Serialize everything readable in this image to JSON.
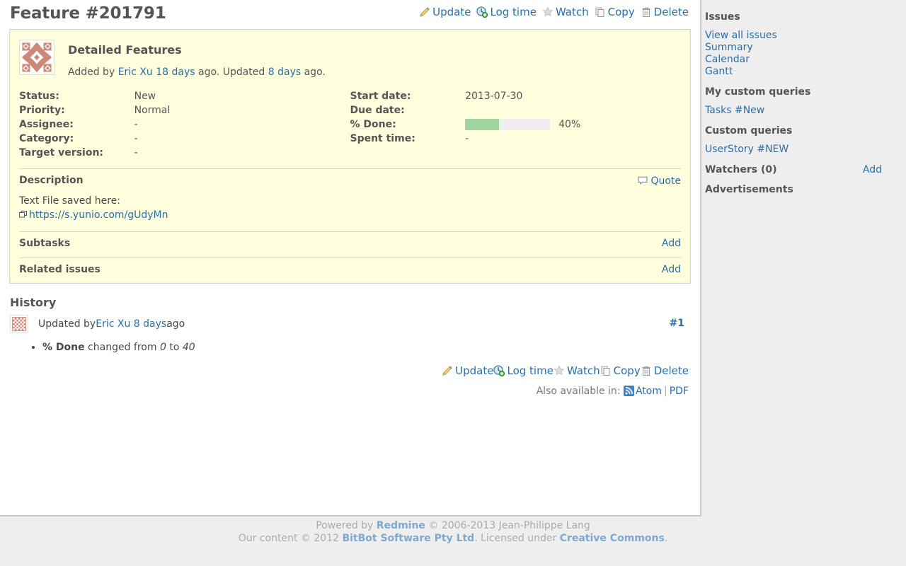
{
  "issue": {
    "title": "Feature #201791",
    "subject": "Detailed Features",
    "author_prefix": "Added by ",
    "author": "Eric Xu",
    "author_age": "18 days",
    "author_mid": " ago. Updated ",
    "updated_age": "8 days",
    "author_suffix": " ago."
  },
  "contextual": {
    "update": "Update",
    "log_time": "Log time",
    "watch": "Watch",
    "copy": "Copy",
    "delete": "Delete"
  },
  "attributes": {
    "status_label": "Status:",
    "status_value": "New",
    "priority_label": "Priority:",
    "priority_value": "Normal",
    "assignee_label": "Assignee:",
    "assignee_value": "-",
    "category_label": "Category:",
    "category_value": "-",
    "target_version_label": "Target version:",
    "target_version_value": "-",
    "start_date_label": "Start date:",
    "start_date_value": "2013-07-30",
    "due_date_label": "Due date:",
    "due_date_value": "",
    "done_label": "% Done:",
    "done_percent": 40,
    "done_text": "40%",
    "spent_time_label": "Spent time:",
    "spent_time_value": "-"
  },
  "description": {
    "heading": "Description",
    "quote": "Quote",
    "text": "Text File saved here:",
    "link": "https://s.yunio.com/gUdyMn"
  },
  "subtasks": {
    "heading": "Subtasks",
    "add": "Add"
  },
  "related": {
    "heading": "Related issues",
    "add": "Add"
  },
  "history": {
    "heading": "History",
    "entry_prefix": "Updated by ",
    "entry_user": "Eric Xu",
    "entry_age": "8 days",
    "entry_suffix": " ago",
    "anchor": "#1",
    "detail_field": "% Done",
    "detail_mid": " changed from ",
    "detail_old": "0",
    "detail_to": " to ",
    "detail_new": "40"
  },
  "other_formats": {
    "label": "Also available in:",
    "atom": "Atom",
    "separator": "|",
    "pdf": "PDF"
  },
  "sidebar": {
    "issues_heading": "Issues",
    "issue_links": [
      "View all issues",
      "Summary",
      "Calendar",
      "Gantt"
    ],
    "my_queries_heading": "My custom queries",
    "my_queries": [
      "Tasks #New"
    ],
    "custom_queries_heading": "Custom queries",
    "custom_queries": [
      "UserStory #NEW"
    ],
    "watchers_heading": "Watchers (0)",
    "watchers_add": "Add",
    "advertisements_heading": "Advertisements"
  },
  "footer": {
    "powered_by": "Powered by ",
    "redmine": "Redmine",
    "copyright": " © 2006-2013 Jean-Philippe Lang",
    "our_content": "Our content © 2012 ",
    "bitbot": "BitBot Software Pty Ltd",
    "licensed": ". Licensed under ",
    "creative_commons": "Creative Commons",
    "period": "."
  },
  "colors": {
    "issue_box_bg": "#ffffdd",
    "link": "#2a6ea8",
    "progress_done": "#9fd49f",
    "progress_todo": "#eeeeee",
    "avatar": "#cc8878"
  }
}
